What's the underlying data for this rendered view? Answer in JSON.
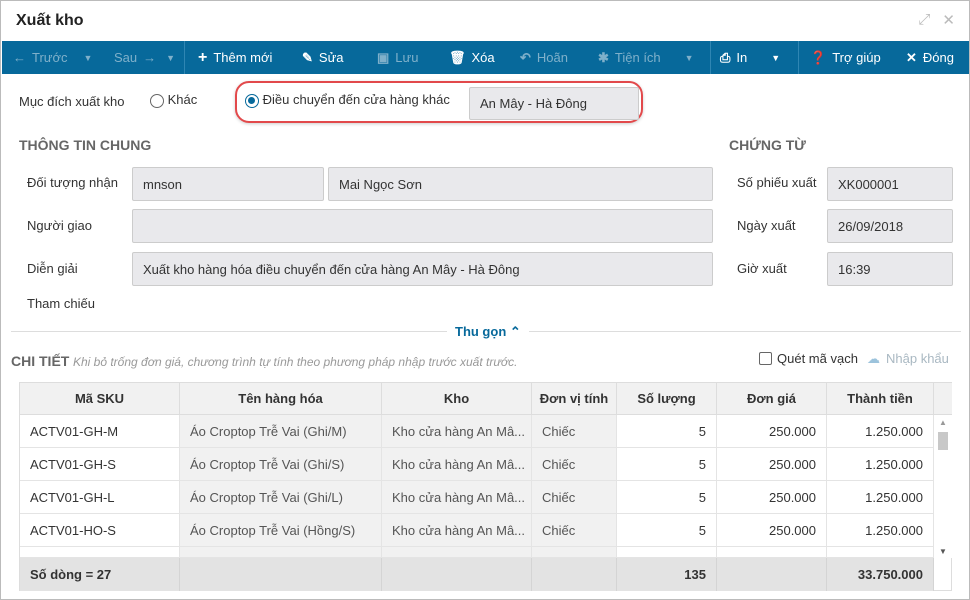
{
  "window": {
    "title": "Xuất kho"
  },
  "toolbar": {
    "prev": "Trước",
    "next": "Sau",
    "add": "Thêm mới",
    "edit": "Sửa",
    "save": "Lưu",
    "delete": "Xóa",
    "postpone": "Hoãn",
    "utilities": "Tiện ích",
    "print": "In",
    "help": "Trợ giúp",
    "close": "Đóng"
  },
  "purpose": {
    "label": "Mục đích xuất kho",
    "option_other": "Khác",
    "option_transfer": "Điều chuyển đến cửa hàng khác",
    "selected": "transfer",
    "store": "An Mây - Hà Đông"
  },
  "general": {
    "title": "THÔNG TIN CHUNG",
    "recipient_label": "Đối tượng nhận",
    "recipient_code": "mnson",
    "recipient_name": "Mai Ngọc Sơn",
    "deliverer_label": "Người giao",
    "deliverer": "",
    "description_label": "Diễn giải",
    "description": "Xuất kho hàng hóa điều chuyển đến cửa hàng An Mây - Hà Đông",
    "reference_label": "Tham chiếu"
  },
  "voucher": {
    "title": "CHỨNG TỪ",
    "number_label": "Số phiếu xuất",
    "number": "XK000001",
    "date_label": "Ngày xuất",
    "date": "26/09/2018",
    "time_label": "Giờ xuất",
    "time": "16:39"
  },
  "collapse": "Thu gọn",
  "detail": {
    "title": "CHI TIẾT",
    "hint": "Khi bỏ trống đơn giá, chương trình tự tính theo phương pháp nhập trước xuất trước.",
    "barcode": "Quét mã vạch",
    "import": "Nhập khẩu",
    "columns": [
      "Mã SKU",
      "Tên hàng hóa",
      "Kho",
      "Đơn vị tính",
      "Số lượng",
      "Đơn giá",
      "Thành tiền"
    ],
    "rows": [
      [
        "ACTV01-GH-M",
        "Áo Croptop Trễ Vai (Ghi/M)",
        "Kho cửa hàng An Mâ...",
        "Chiếc",
        "5",
        "250.000",
        "1.250.000"
      ],
      [
        "ACTV01-GH-S",
        "Áo Croptop Trễ Vai (Ghi/S)",
        "Kho cửa hàng An Mâ...",
        "Chiếc",
        "5",
        "250.000",
        "1.250.000"
      ],
      [
        "ACTV01-GH-L",
        "Áo Croptop Trễ Vai (Ghi/L)",
        "Kho cửa hàng An Mâ...",
        "Chiếc",
        "5",
        "250.000",
        "1.250.000"
      ],
      [
        "ACTV01-HO-S",
        "Áo Croptop Trễ Vai (Hồng/S)",
        "Kho cửa hàng An Mâ...",
        "Chiếc",
        "5",
        "250.000",
        "1.250.000"
      ]
    ],
    "footer": {
      "count": "Số dòng = 27",
      "qty": "135",
      "total": "33.750.000"
    }
  }
}
